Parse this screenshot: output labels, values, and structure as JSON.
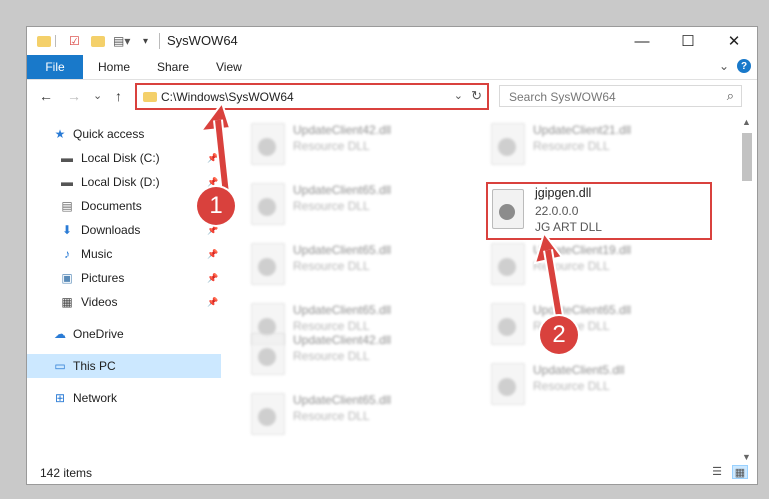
{
  "window": {
    "title": "SysWOW64",
    "controls": {
      "minimize": "—",
      "maximize": "☐",
      "close": "✕"
    }
  },
  "ribbon": {
    "tabs": [
      "File",
      "Home",
      "Share",
      "View"
    ],
    "help": "?"
  },
  "navigation": {
    "back": "←",
    "forward": "→",
    "recent": "⌄",
    "up": "↑",
    "address": "C:\\Windows\\SysWOW64",
    "address_dropdown": "⌄",
    "refresh": "↻",
    "search_placeholder": "Search SysWOW64",
    "search_icon": "⌕"
  },
  "sidebar": {
    "items": [
      {
        "label": "Quick access",
        "icon": "star-icon",
        "glyph": "★",
        "pinned": false
      },
      {
        "label": "Local Disk (C:)",
        "icon": "drive-icon",
        "glyph": "▬",
        "pinned": true
      },
      {
        "label": "Local Disk (D:)",
        "icon": "drive-icon",
        "glyph": "▬",
        "pinned": true
      },
      {
        "label": "Documents",
        "icon": "documents-icon",
        "glyph": "▤",
        "pinned": true
      },
      {
        "label": "Downloads",
        "icon": "download-icon",
        "glyph": "⬇",
        "pinned": true
      },
      {
        "label": "Music",
        "icon": "music-icon",
        "glyph": "♪",
        "pinned": true
      },
      {
        "label": "Pictures",
        "icon": "pictures-icon",
        "glyph": "▣",
        "pinned": true
      },
      {
        "label": "Videos",
        "icon": "videos-icon",
        "glyph": "▦",
        "pinned": true
      },
      {
        "label": "OneDrive",
        "icon": "cloud-icon",
        "glyph": "☁",
        "pinned": false
      },
      {
        "label": "This PC",
        "icon": "computer-icon",
        "glyph": "▭",
        "pinned": false,
        "selected": true
      },
      {
        "label": "Network",
        "icon": "network-icon",
        "glyph": "⊞",
        "pinned": false
      }
    ],
    "pin_glyph": "📌"
  },
  "files": {
    "left": [
      {
        "name": "UpdateClient42.dll",
        "type": "Resource DLL"
      },
      {
        "name": "UpdateClient65.dll",
        "type": "Resource DLL"
      },
      {
        "name": "UpdateClient65.dll",
        "type": "Resource DLL"
      },
      {
        "name": "UpdateClient65.dll",
        "type": "Resource DLL"
      },
      {
        "name": "UpdateClient42.dll",
        "type": "Resource DLL"
      },
      {
        "name": "UpdateClient65.dll",
        "type": "Resource DLL"
      }
    ],
    "right": [
      {
        "name": "UpdateClient21.dll",
        "type": "Resource DLL"
      },
      {
        "name": "UpdateClient19.dll",
        "type": "Resource DLL"
      },
      {
        "name": "UpdateClient65.dll",
        "type": "Resource DLL"
      },
      {
        "name": "UpdateClient5.dll",
        "type": "Resource DLL"
      }
    ],
    "highlighted": {
      "name": "jgipgen.dll",
      "version": "22.0.0.0",
      "description": "JG ART DLL"
    }
  },
  "annotations": {
    "badge1": "1",
    "badge2": "2",
    "accent": "#d9413d"
  },
  "status": {
    "item_count": "142 items",
    "details_view": "☰",
    "tiles_view": "▦"
  },
  "scrollbar": {
    "up": "▲",
    "down": "▼"
  }
}
